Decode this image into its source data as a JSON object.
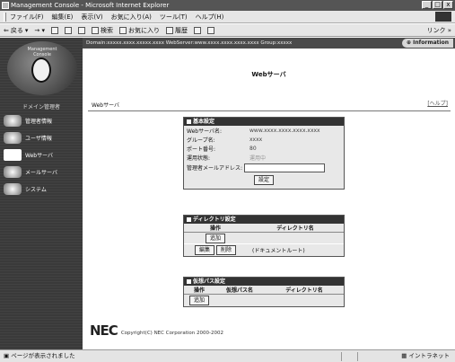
{
  "window": {
    "title": "Management Console - Microsoft Internet Explorer",
    "controls": [
      "_",
      "□",
      "x"
    ]
  },
  "menubar": {
    "items": [
      "ファイル(F)",
      "編集(E)",
      "表示(V)",
      "お気に入り(A)",
      "ツール(T)",
      "ヘルプ(H)"
    ]
  },
  "toolbar": {
    "back": "戻る",
    "search": "検索",
    "favorites": "お気に入り",
    "history": "履歴",
    "links": "リンク »"
  },
  "sidebar": {
    "logo_text": "Management Console",
    "section_title": "ドメイン管理者",
    "items": [
      {
        "label": "管理者情報"
      },
      {
        "label": "ユーザ情報"
      },
      {
        "label": "Webサーバ",
        "active": true
      },
      {
        "label": "メールサーバ"
      },
      {
        "label": "システム"
      }
    ]
  },
  "header": {
    "domain_line": "Domain:xxxxx.xxxx.xxxxx.xxxx WebServer:www.xxxx.xxxx.xxxx.xxxx Group:xxxxx",
    "info_button": "Information"
  },
  "page": {
    "title": "Webサーバ",
    "breadcrumb": "Webサーバ",
    "help": "[ヘルプ]"
  },
  "basic_settings": {
    "title": "基本設定",
    "rows": [
      {
        "key": "Webサーバ名:",
        "value": "www.xxxx.xxxx.xxxx.xxxx"
      },
      {
        "key": "グループ名:",
        "value": "xxxx"
      },
      {
        "key": "ポート番号:",
        "value": "80"
      },
      {
        "key": "運用状態:",
        "value": "運用中"
      }
    ],
    "admin_mail_label": "管理者メールアドレス:",
    "admin_mail_value": "",
    "set_button": "設定"
  },
  "directory_settings": {
    "title": "ディレクトリ設定",
    "columns": [
      "操作",
      "ディレクトリ名"
    ],
    "add_button": "追加",
    "edit_button": "編集",
    "delete_button": "削除",
    "directory_name": "(ドキュメントルート)"
  },
  "virtual_path_settings": {
    "title": "仮想パス設定",
    "columns": [
      "操作",
      "仮想パス名",
      "ディレクトリ名"
    ],
    "add_button": "追加"
  },
  "footer": {
    "logo": "NEC",
    "copyright": "Copyright(C) NEC Corporation 2000-2002"
  },
  "statusbar": {
    "left": "ページが表示されました",
    "right": "イントラネット"
  }
}
